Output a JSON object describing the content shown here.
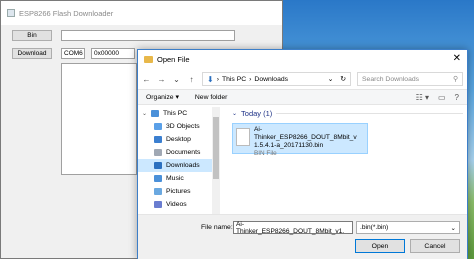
{
  "app": {
    "title": "ESP8266 Flash Downloader",
    "bin_label": "Bin",
    "download_label": "Download",
    "com_port": "COM6",
    "address": "0x00000"
  },
  "dialog": {
    "title": "Open File",
    "close_glyph": "✕",
    "nav": {
      "back": "←",
      "forward": "→",
      "down": "⌄",
      "up": "↑"
    },
    "breadcrumb": [
      "This PC",
      "Downloads"
    ],
    "breadcrumb_sep": "›",
    "address_dropdown": "⌄",
    "refresh": "↻",
    "search_placeholder": "Search Downloads",
    "search_icon": "⚲",
    "organize_label": "Organize ▾",
    "new_folder_label": "New folder",
    "view_icon": "☷ ▾",
    "preview_icon": "▭",
    "help_icon": "?",
    "sidebar": [
      {
        "label": "This PC",
        "color": "#4a90d9"
      },
      {
        "label": "3D Objects",
        "color": "#5aa0e8"
      },
      {
        "label": "Desktop",
        "color": "#3b7fd0"
      },
      {
        "label": "Documents",
        "color": "#a0a8b4"
      },
      {
        "label": "Downloads",
        "color": "#2b6fbf"
      },
      {
        "label": "Music",
        "color": "#4a90d9"
      },
      {
        "label": "Pictures",
        "color": "#6aa8e0"
      },
      {
        "label": "Videos",
        "color": "#6a7dd0"
      }
    ],
    "group_label": "Today (1)",
    "file": {
      "name_line1": "Ai-Thinker_ESP8266_DOUT_8Mbit_v",
      "name_line2": "1.5.4.1-a_20171130.bin",
      "type": "BIN File"
    },
    "file_name_label": "File name:",
    "file_name_value": "Ai-Thinker_ESP8266_DOUT_8Mbit_v1.",
    "filter_value": ".bin(*.bin)",
    "open_label": "Open",
    "cancel_label": "Cancel"
  }
}
